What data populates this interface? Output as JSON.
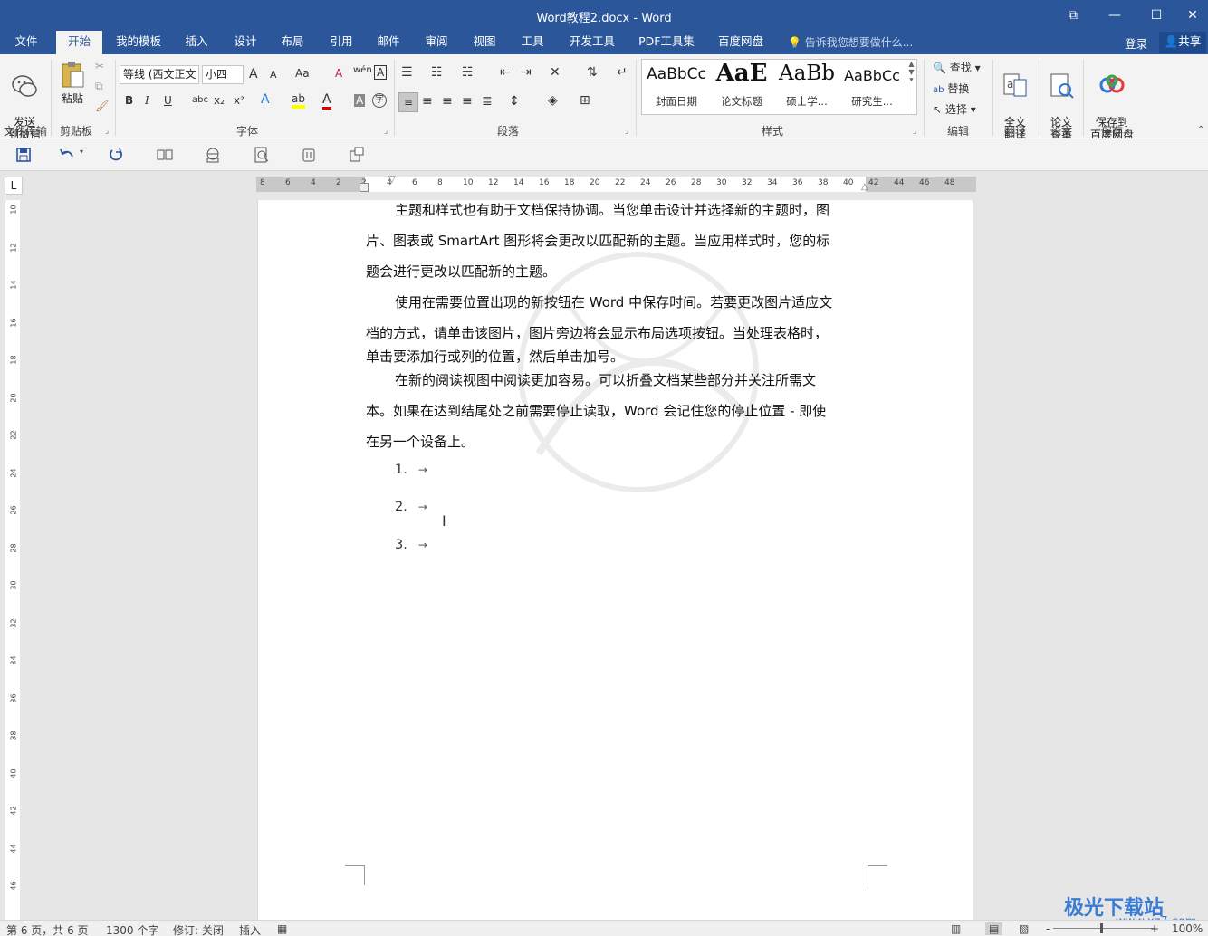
{
  "window": {
    "title": "Word教程2.docx - Word",
    "controls": [
      "⧉",
      "—",
      "☐",
      "✕"
    ]
  },
  "tabs": [
    {
      "label": "文件"
    },
    {
      "label": "开始"
    },
    {
      "label": "我的模板"
    },
    {
      "label": "插入"
    },
    {
      "label": "设计"
    },
    {
      "label": "布局"
    },
    {
      "label": "引用"
    },
    {
      "label": "邮件"
    },
    {
      "label": "审阅"
    },
    {
      "label": "视图"
    },
    {
      "label": "工具"
    },
    {
      "label": "开发工具"
    },
    {
      "label": "PDF工具集"
    },
    {
      "label": "百度网盘"
    }
  ],
  "active_tab": "开始",
  "tellme": "告诉我您想要做什么...",
  "login": "登录",
  "share": "共享",
  "ribbon": {
    "send_wechat": "发送\n到微信",
    "paste": "粘贴",
    "font_name": "等线 (西文正文",
    "font_size": "小四",
    "groups": {
      "file_transfer": "文件传输",
      "clipboard": "剪贴板",
      "font": "字体",
      "paragraph": "段落",
      "styles": "样式",
      "editing": "编辑",
      "translate": "翻译",
      "paper": "论文",
      "save": "保存"
    },
    "styles": [
      {
        "preview": "AaBbCc",
        "name": "封面日期"
      },
      {
        "preview": "AaE",
        "name": "论文标题"
      },
      {
        "preview": "AaBb",
        "name": "硕士学..."
      },
      {
        "preview": "AaBbCc",
        "name": "研究生..."
      }
    ],
    "find": "查找",
    "replace": "替换",
    "select": "选择",
    "full_translate": "全文\n翻译",
    "paper_check": "论文\n查重",
    "save_baidu": "保存到\n百度网盘",
    "format_labels": {
      "bold": "B",
      "italic": "I",
      "underline": "U",
      "strike": "abc",
      "sub": "x₂",
      "sup": "x²",
      "grow": "A",
      "shrink": "A",
      "case": "Aa",
      "clear": "A",
      "phonetic": "wén",
      "border": "A"
    }
  },
  "ruler": {
    "h_ticks": [
      "8",
      "6",
      "4",
      "2",
      "2",
      "4",
      "6",
      "8",
      "10",
      "12",
      "14",
      "16",
      "18",
      "20",
      "22",
      "24",
      "26",
      "28",
      "30",
      "32",
      "34",
      "36",
      "38",
      "40",
      "42",
      "44",
      "46",
      "48"
    ],
    "v_ticks": [
      "10",
      "12",
      "14",
      "16",
      "18",
      "20",
      "22",
      "24",
      "26",
      "28",
      "30",
      "32",
      "34",
      "36",
      "38",
      "40",
      "42",
      "44",
      "46",
      "48"
    ]
  },
  "document": {
    "paragraphs": [
      {
        "lines": [
          "主题和样式也有助于文档保持协调。当您单击设计并选择新的主题时，图",
          "片、图表或 SmartArt 图形将会更改以匹配新的主题。当应用样式时，您的标",
          "题会进行更改以匹配新的主题。"
        ]
      },
      {
        "lines": [
          "使用在需要位置出现的新按钮在 Word 中保存时间。若要更改图片适应文",
          "档的方式，请单击该图片，图片旁边将会显示布局选项按钮。当处理表格时，",
          "单击要添加行或列的位置，然后单击加号。"
        ]
      },
      {
        "lines": [
          "在新的阅读视图中阅读更加容易。可以折叠文档某些部分并关注所需文",
          "本。如果在达到结尾处之前需要停止读取，Word 会记住您的停止位置 - 即使",
          "在另一个设备上。"
        ]
      }
    ],
    "list": [
      "1.",
      "2.",
      "3."
    ],
    "list_arrow": "→"
  },
  "status": {
    "page": "第 6 页，共 6 页",
    "words": "1300 个字",
    "track": "修订: 关闭",
    "insert": "插入",
    "zoom": "100%",
    "zoom_minus": "-",
    "zoom_plus": "+"
  },
  "brand": {
    "logo": "极光下载站",
    "url": "www.xz7.com"
  },
  "colors": {
    "title_bar": "#2b579a",
    "ribbon": "#f3f3f3",
    "highlight_yellow": "#ffff00",
    "font_red": "#e00000"
  }
}
